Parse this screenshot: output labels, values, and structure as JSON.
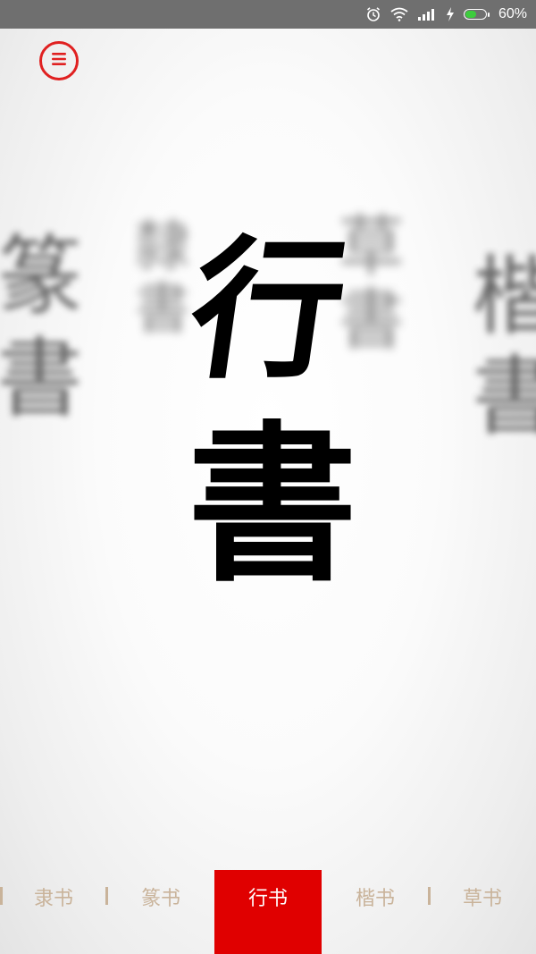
{
  "status_bar": {
    "battery_text": "60%",
    "battery_level": 0.6,
    "icons": [
      "alarm-icon",
      "wifi-icon",
      "signal-icon",
      "charging-icon",
      "battery-icon"
    ],
    "accent_battery": "#3dcc3d"
  },
  "menu": {
    "icon": "menu-icon",
    "color": "#e02020"
  },
  "calligraphy": {
    "main": [
      "行",
      "書"
    ],
    "background_left": "篆書",
    "background_right": "楷書",
    "background_mid_left": "隸書",
    "background_mid_right": "草書"
  },
  "tabs": [
    {
      "label": "隶书",
      "active": false
    },
    {
      "label": "篆书",
      "active": false
    },
    {
      "label": "行书",
      "active": true
    },
    {
      "label": "楷书",
      "active": false
    },
    {
      "label": "草书",
      "active": false
    }
  ],
  "colors": {
    "active_tab_bg": "#e00000",
    "inactive_tab_text": "#c9b39a"
  }
}
